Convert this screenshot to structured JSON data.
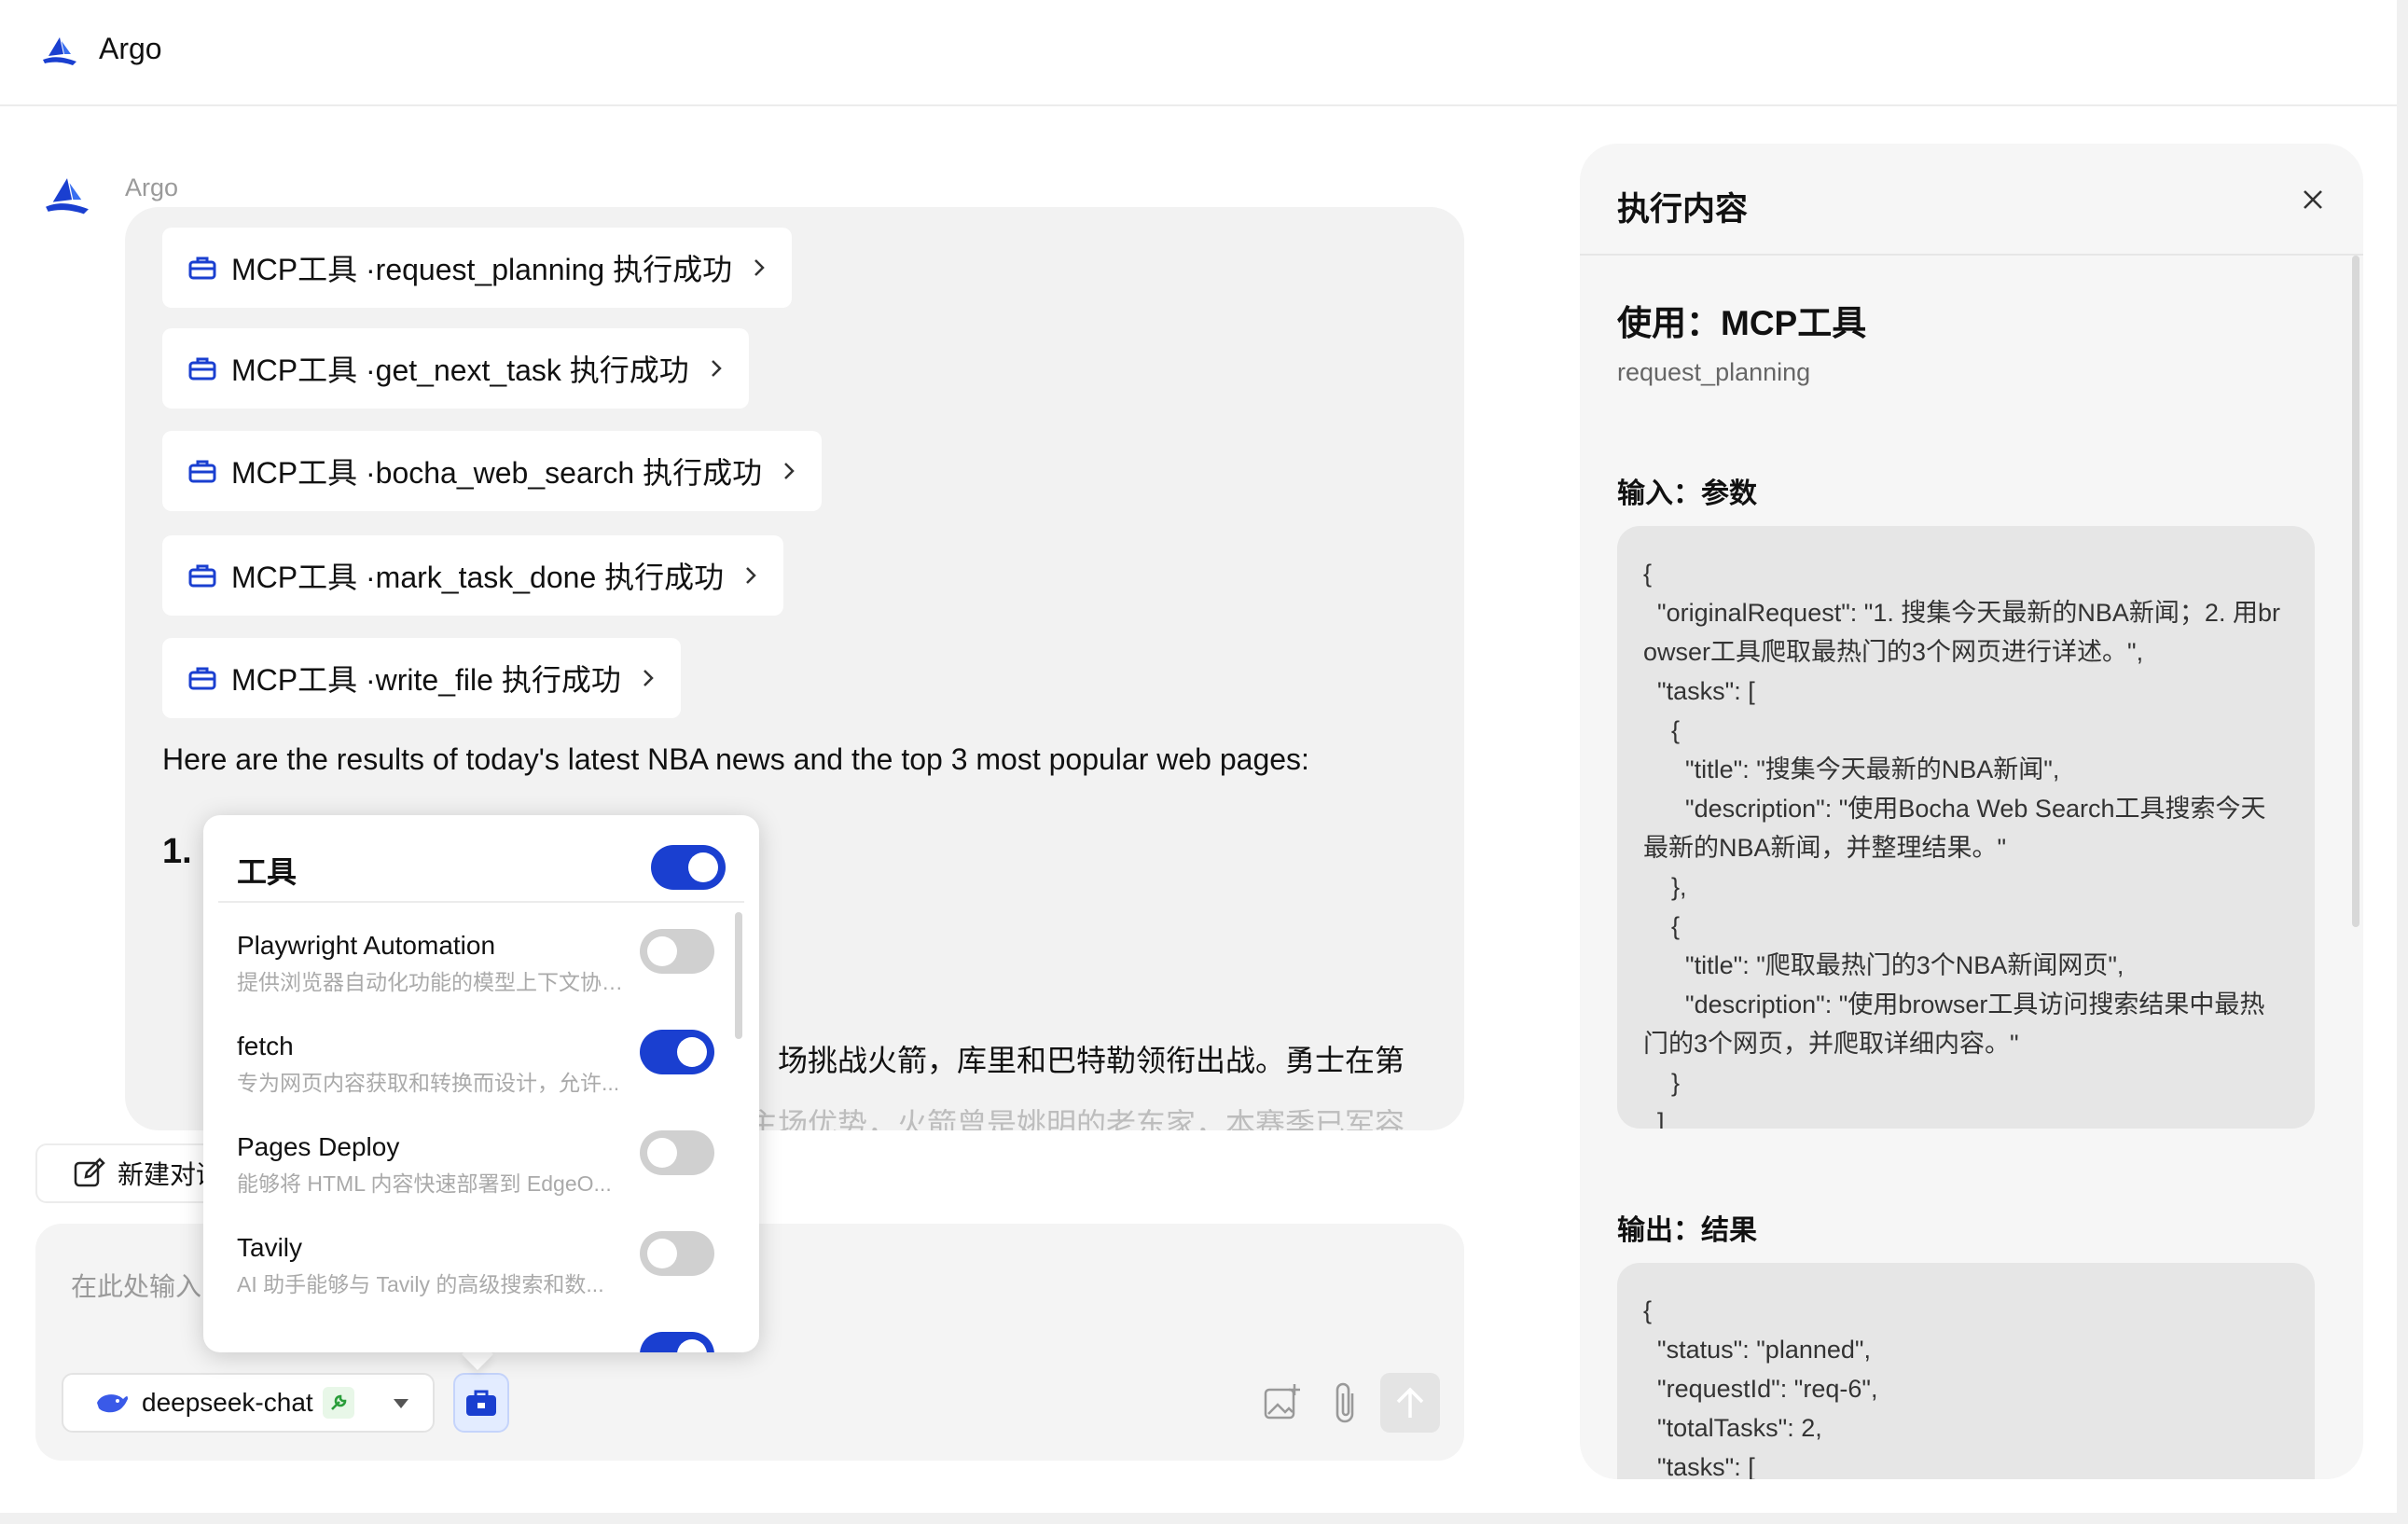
{
  "app": {
    "title": "Argo"
  },
  "message": {
    "sender": "Argo",
    "tool_calls": [
      {
        "label": "MCP工具 ·request_planning 执行成功"
      },
      {
        "label": "MCP工具 ·get_next_task 执行成功"
      },
      {
        "label": "MCP工具 ·bocha_web_search 执行成功"
      },
      {
        "label": "MCP工具 ·mark_task_done 执行成功"
      },
      {
        "label": "MCP工具 ·write_file 执行成功"
      }
    ],
    "result_text": "Here are the results of today's latest NBA news and the top 3 most popular web pages:",
    "heading_number": "1.",
    "partial_line1": "。场挑战火箭，库里和巴特勒领衔出战。勇士在第",
    "partial_line2": "主场优势，火箭曾是姚明的老东家，本赛季已军容"
  },
  "new_chat": {
    "label": "新建对话"
  },
  "composer": {
    "placeholder": "在此处输入",
    "model": "deepseek-chat"
  },
  "tools_popup": {
    "title": "工具",
    "master_enabled": true,
    "tools": [
      {
        "name": "Playwright Automation",
        "desc": "提供浏览器自动化功能的模型上下文协议...",
        "enabled": false
      },
      {
        "name": "fetch",
        "desc": "专为网页内容获取和转换而设计，允许...",
        "enabled": true
      },
      {
        "name": "Pages Deploy",
        "desc": "能够将 HTML 内容快速部署到 EdgeO...",
        "enabled": false
      },
      {
        "name": "Tavily",
        "desc": "AI 助手能够与 Tavily 的高级搜索和数...",
        "enabled": false
      }
    ]
  },
  "panel": {
    "title": "执行内容",
    "use_title": "使用：MCP工具",
    "use_sub": "request_planning",
    "input_label": "输入：参数",
    "input_code": "{\n  \"originalRequest\": \"1. 搜集今天最新的NBA新闻；2. 用browser工具爬取最热门的3个网页进行详述。\",\n  \"tasks\": [\n    {\n      \"title\": \"搜集今天最新的NBA新闻\",\n      \"description\": \"使用Bocha Web Search工具搜索今天最新的NBA新闻，并整理结果。\"\n    },\n    {\n      \"title\": \"爬取最热门的3个NBA新闻网页\",\n      \"description\": \"使用browser工具访问搜索结果中最热门的3个网页，并爬取详细内容。\"\n    }\n  ]",
    "output_label": "输出：结果",
    "output_code": "{\n  \"status\": \"planned\",\n  \"requestId\": \"req-6\",\n  \"totalTasks\": 2,\n  \"tasks\": ["
  },
  "colors": {
    "accent": "#1a3fd0",
    "toggle_off": "#d0d0d0"
  }
}
